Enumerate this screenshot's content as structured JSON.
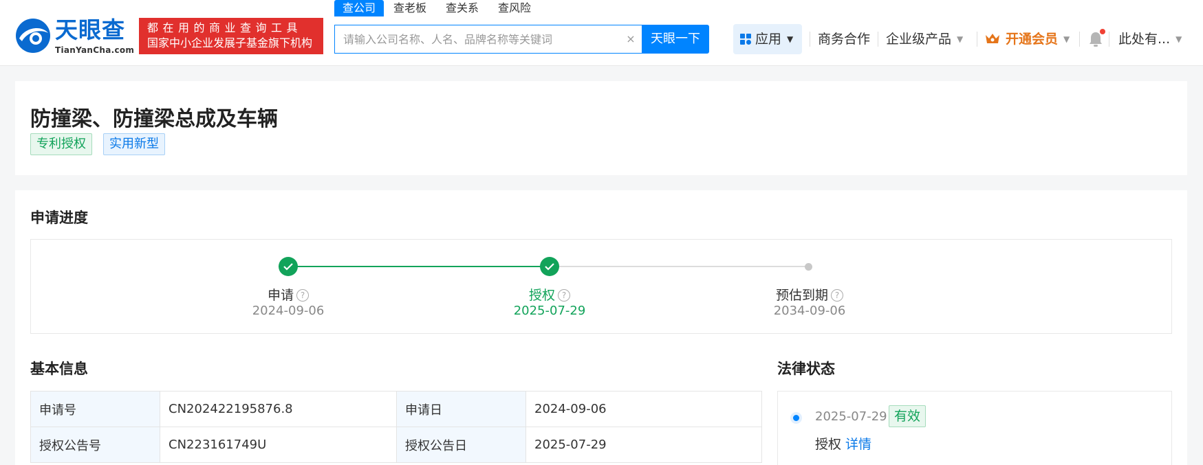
{
  "header": {
    "logo_text": "天眼查",
    "logo_sub": "TianYanCha.com",
    "slogan_line1": "都在用的商业查询工具",
    "slogan_line2": "国家中小企业发展子基金旗下机构",
    "search_tabs": [
      "查公司",
      "查老板",
      "查关系",
      "查风险"
    ],
    "search_placeholder": "请输入公司名称、人名、品牌名称等关键词",
    "search_button": "天眼一下",
    "nav": {
      "apps": "应用",
      "business": "商务合作",
      "enterprise": "企业级产品",
      "vip": "开通会员",
      "user": "此处有..."
    }
  },
  "patent": {
    "title": "防撞梁、防撞梁总成及车辆",
    "tags": [
      "专利授权",
      "实用新型"
    ]
  },
  "progress": {
    "section_title": "申请进度",
    "steps": [
      {
        "label": "申请",
        "date": "2024-09-06",
        "state": "done"
      },
      {
        "label": "授权",
        "date": "2025-07-29",
        "state": "current"
      },
      {
        "label": "预估到期",
        "date": "2034-09-06",
        "state": "pending"
      }
    ]
  },
  "basic_info": {
    "section_title": "基本信息",
    "rows": [
      {
        "k1": "申请号",
        "v1": "CN202422195876.8",
        "k2": "申请日",
        "v2": "2024-09-06"
      },
      {
        "k1": "授权公告号",
        "v1": "CN223161749U",
        "k2": "授权公告日",
        "v2": "2025-07-29"
      }
    ]
  },
  "legal_status": {
    "section_title": "法律状态",
    "items": [
      {
        "date": "2025-07-29",
        "status": "有效",
        "type": "授权",
        "detail": "详情"
      }
    ]
  },
  "colors": {
    "brand_blue": "#0084ff",
    "success_green": "#12a35a",
    "slogan_red": "#e1302d",
    "vip_orange": "#e5751a"
  }
}
